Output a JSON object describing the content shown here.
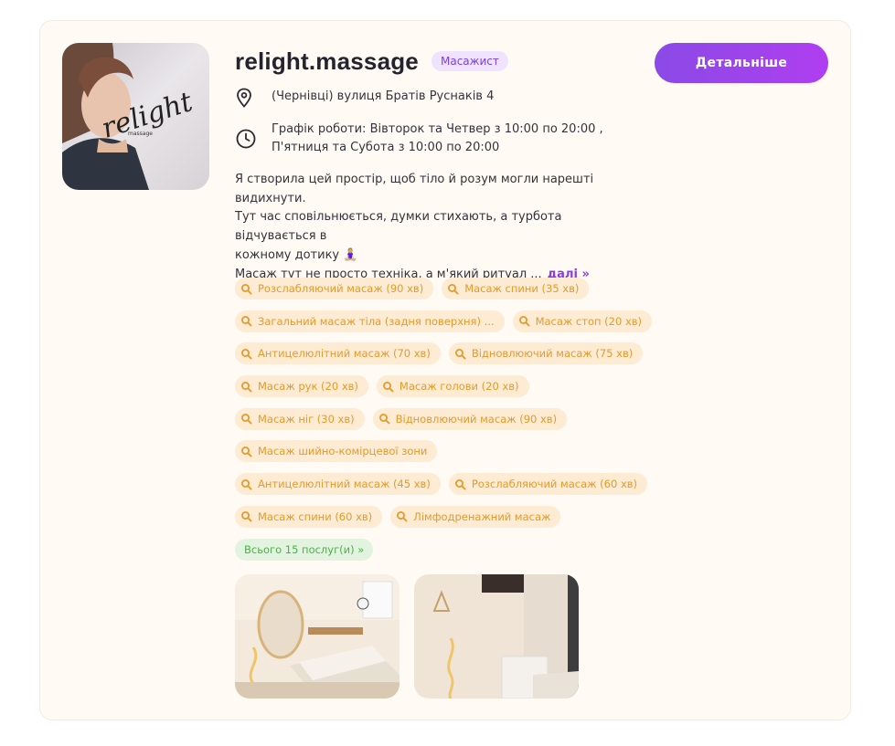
{
  "profile": {
    "name": "relight.massage",
    "role": "Масажист",
    "details_button": "Детальніше",
    "address": "(Чернівці) вулиця Братів Руснаків 4",
    "schedule_line1": "Графік роботи: Вівторок та Четвер з 10:00 по 20:00 ,",
    "schedule_line2": "П'ятниця та Субота з 10:00 по 20:00",
    "description_line1": "Я створила цей простір, щоб тіло й розум могли нарешті",
    "description_line2": "видихнути.",
    "description_line3": "Тут час сповільнюється, думки стихають, а турбота відчувається в",
    "description_line4": "кожному дотику 🧘🏼‍♀️",
    "description_line5": "Масаж тут не просто техніка, а м'який ритуал ...",
    "more_link": "далі »",
    "logo_text": "relight",
    "logo_subtext": "massage"
  },
  "services": [
    "Розслабляючий масаж (90 хв)",
    "Масаж спини (35 хв)",
    "Загальний масаж тіла (задня поверхня) ...",
    "Масаж стоп (20 хв)",
    "Антицелюлітний масаж (70 хв)",
    "Відновлюючий масаж (75 хв)",
    "Масаж рук (20 хв)",
    "Масаж голови (20 хв)",
    "Масаж ніг (30 хв)",
    "Відновлюючий масаж (90 хв)",
    "Масаж шийно-комірцевої зони",
    "Антицелюлітний масаж (45 хв)",
    "Розслабляючий масаж (60 хв)",
    "Масаж спини (60 хв)",
    "Лімфодренажний масаж"
  ],
  "total_services": "Всього 15 послуг(и) »",
  "colors": {
    "accent": "#8a4ae6",
    "tag_bg": "#fdebd3",
    "tag_text": "#e49b2b",
    "total_bg": "#e2f4df",
    "total_text": "#4daf4a",
    "role_bg": "#efe3ff"
  }
}
